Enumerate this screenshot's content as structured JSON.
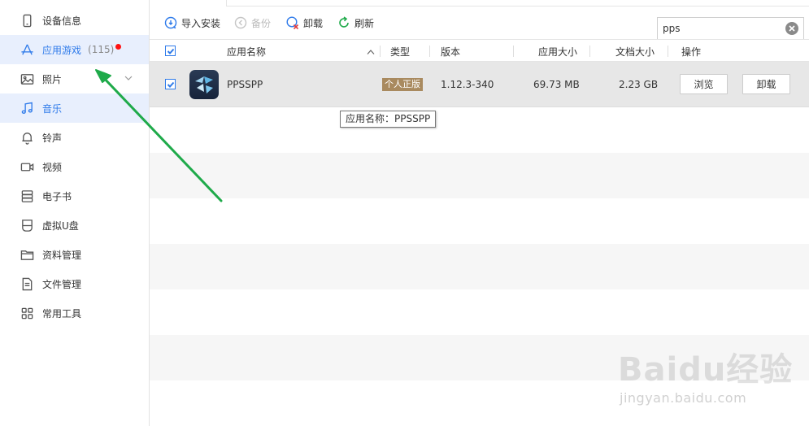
{
  "sidebar": {
    "items": [
      {
        "label": "设备信息",
        "icon": "phone-icon"
      },
      {
        "label": "应用游戏",
        "icon": "apps-icon",
        "count": "(115)",
        "active": true
      },
      {
        "label": "照片",
        "icon": "image-icon"
      },
      {
        "label": "音乐",
        "icon": "music-icon"
      },
      {
        "label": "铃声",
        "icon": "bell-icon"
      },
      {
        "label": "视频",
        "icon": "video-icon"
      },
      {
        "label": "电子书",
        "icon": "book-icon"
      },
      {
        "label": "虚拟U盘",
        "icon": "usb-drive-icon"
      },
      {
        "label": "资料管理",
        "icon": "folder-icon"
      },
      {
        "label": "文件管理",
        "icon": "file-icon"
      },
      {
        "label": "常用工具",
        "icon": "grid-icon"
      }
    ]
  },
  "toolbar": {
    "import_label": "导入安装",
    "backup_label": "备份",
    "uninstall_label": "卸载",
    "refresh_label": "刷新"
  },
  "search": {
    "value": "pps"
  },
  "table": {
    "columns": {
      "name": "应用名称",
      "type": "类型",
      "version": "版本",
      "app_size": "应用大小",
      "doc_size": "文档大小",
      "action": "操作"
    },
    "rows": [
      {
        "name": "PPSSPP",
        "type": "个人正版",
        "version": "1.12.3-340",
        "app_size": "69.73 MB",
        "doc_size": "2.23 GB",
        "browse_label": "浏览",
        "uninstall_label": "卸载",
        "checked": true
      }
    ]
  },
  "tooltip": "应用名称：PPSSPP",
  "watermark": {
    "logo": "Baidu经验",
    "url": "jingyan.baidu.com"
  },
  "colors": {
    "accent": "#2f7bea",
    "arrow": "#1faa4a",
    "badge": "#a98a5f",
    "red_dot": "#ff1111"
  }
}
